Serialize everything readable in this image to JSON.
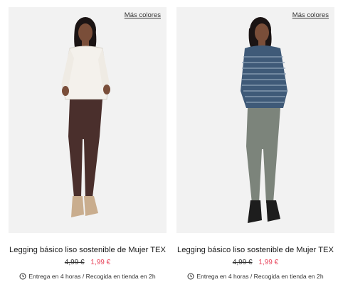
{
  "products": [
    {
      "more_colors": "Más colores",
      "title": "Legging básico liso sostenible de Mujer TEX",
      "old_price": "4,99 €",
      "new_price": "1,99 €",
      "delivery": "Entrega en 4 horas / Recogida en tienda en 2h",
      "colors": {
        "top": "#f4f1ec",
        "legging": "#4a2f2c",
        "shoes": "#c9ad8e"
      }
    },
    {
      "more_colors": "Más colores",
      "title": "Legging básico liso sostenible de Mujer TEX",
      "old_price": "4,99 €",
      "new_price": "1,99 €",
      "delivery": "Entrega en 4 horas / Recogida en tienda en 2h",
      "colors": {
        "top": "#3f5a78",
        "legging": "#7c847b",
        "shoes": "#1d1d1d"
      }
    }
  ],
  "icons": {
    "delivery": "clock-icon"
  },
  "theme": {
    "sale_price": "#e8455c",
    "photo_bg": "#f2f2f2"
  }
}
